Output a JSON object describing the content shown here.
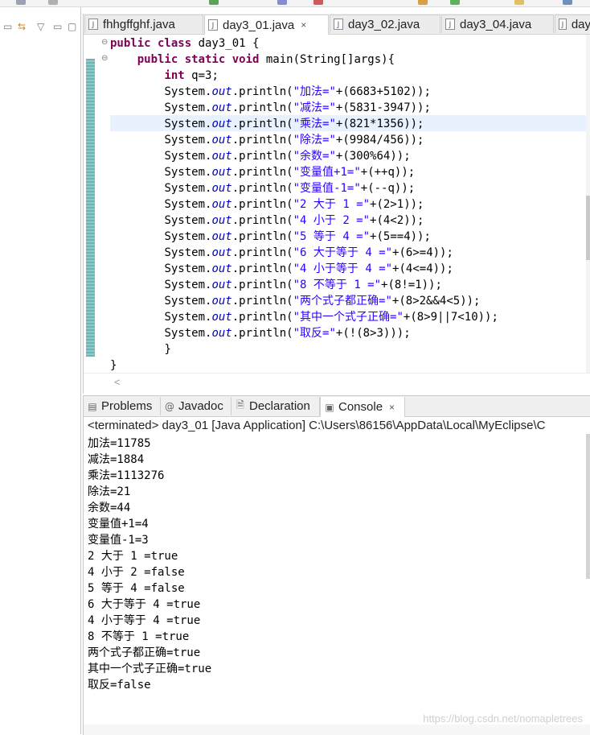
{
  "editor": {
    "tabs": [
      {
        "label": "fhhgffghf.java",
        "active": false
      },
      {
        "label": "day3_01.java",
        "active": true
      },
      {
        "label": "day3_02.java",
        "active": false
      },
      {
        "label": "day3_04.java",
        "active": false
      },
      {
        "label": "day",
        "active": false
      }
    ],
    "close_glyph": "×",
    "code_lines": [
      {
        "kw": "public class ",
        "field": "",
        "rest": "day3_01 {",
        "indent": "",
        "str": ""
      },
      {
        "kw": "public static void ",
        "field": "",
        "rest": "main(String[]args){",
        "indent": "    ",
        "str": ""
      },
      {
        "kw": "int ",
        "field": "",
        "rest": "q=3;",
        "indent": "        ",
        "str": ""
      },
      {
        "indent": "        ",
        "kw": "",
        "field": "out",
        "str": "\"加法=\"",
        "rest": "+(6683+5102));"
      },
      {
        "indent": "        ",
        "kw": "",
        "field": "out",
        "str": "\"减法=\"",
        "rest": "+(5831-3947));"
      },
      {
        "indent": "        ",
        "kw": "",
        "field": "out",
        "str": "\"乘法=\"",
        "rest": "+(821*1356));"
      },
      {
        "indent": "        ",
        "kw": "",
        "field": "out",
        "str": "\"除法=\"",
        "rest": "+(9984/456));"
      },
      {
        "indent": "        ",
        "kw": "",
        "field": "out",
        "str": "\"余数=\"",
        "rest": "+(300%64));"
      },
      {
        "indent": "        ",
        "kw": "",
        "field": "out",
        "str": "\"变量值+1=\"",
        "rest": "+(++q));"
      },
      {
        "indent": "        ",
        "kw": "",
        "field": "out",
        "str": "\"变量值-1=\"",
        "rest": "+(--q));"
      },
      {
        "indent": "        ",
        "kw": "",
        "field": "out",
        "str": "\"2 大于 1 =\"",
        "rest": "+(2>1));"
      },
      {
        "indent": "        ",
        "kw": "",
        "field": "out",
        "str": "\"4 小于 2 =\"",
        "rest": "+(4<2));"
      },
      {
        "indent": "        ",
        "kw": "",
        "field": "out",
        "str": "\"5 等于 4 =\"",
        "rest": "+(5==4));"
      },
      {
        "indent": "        ",
        "kw": "",
        "field": "out",
        "str": "\"6 大于等于 4 =\"",
        "rest": "+(6>=4));"
      },
      {
        "indent": "        ",
        "kw": "",
        "field": "out",
        "str": "\"4 小于等于 4 =\"",
        "rest": "+(4<=4));"
      },
      {
        "indent": "        ",
        "kw": "",
        "field": "out",
        "str": "\"8 不等于 1 =\"",
        "rest": "+(8!=1));"
      },
      {
        "indent": "        ",
        "kw": "",
        "field": "out",
        "str": "\"两个式子都正确=\"",
        "rest": "+(8>2&&4<5));"
      },
      {
        "indent": "        ",
        "kw": "",
        "field": "out",
        "str": "\"其中一个式子正确=\"",
        "rest": "+(8>9||7<10));"
      },
      {
        "indent": "        ",
        "kw": "",
        "field": "out",
        "str": "\"取反=\"",
        "rest": "+(!(8>3)));"
      },
      {
        "indent": "        ",
        "kw": "",
        "field": "",
        "str": "",
        "rest": "}"
      },
      {
        "indent": "",
        "kw": "",
        "field": "",
        "str": "",
        "rest": "}"
      }
    ],
    "sysout_prefix": "System.",
    "println_prefix": ".println(",
    "scroll_left_glyph": "<"
  },
  "bottom_panel": {
    "tabs": [
      {
        "label": "Problems",
        "icon": "problems-icon",
        "active": false
      },
      {
        "label": "Javadoc",
        "icon": "javadoc-icon",
        "active": false
      },
      {
        "label": "Declaration",
        "icon": "declaration-icon",
        "active": false
      },
      {
        "label": "Console",
        "icon": "console-icon",
        "active": true
      }
    ],
    "status": "<terminated> day3_01 [Java Application] C:\\Users\\86156\\AppData\\Local\\MyEclipse\\C",
    "console_lines": [
      "加法=11785",
      "减法=1884",
      "乘法=1113276",
      "除法=21",
      "余数=44",
      "变量值+1=4",
      "变量值-1=3",
      "2 大于 1 =true",
      "4 小于 2 =false",
      "5 等于 4 =false",
      "6 大于等于 4 =true",
      "4 小于等于 4 =true",
      "8 不等于 1 =true",
      "两个式子都正确=true",
      "其中一个式子正确=true",
      "取反=false"
    ],
    "watermark": "https://blog.csdn.net/nomapletrees"
  },
  "colors": {
    "keyword": "#7f0055",
    "field": "#0000c0",
    "string": "#2a00ff",
    "current_line": "#e8f2fe",
    "change_bar": "#6fb4b4"
  }
}
